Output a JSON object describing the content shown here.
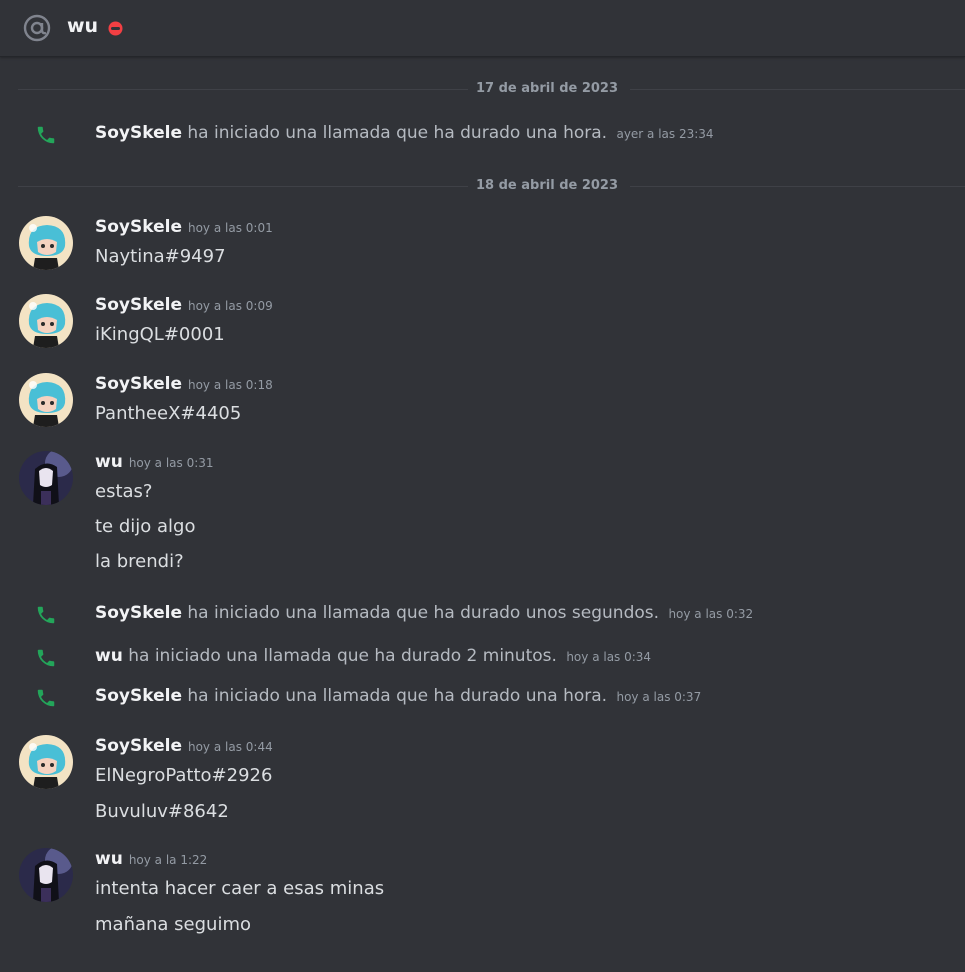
{
  "header": {
    "title": "wu",
    "status": "do-not-disturb",
    "channel_icon": "at-sign-icon"
  },
  "colors": {
    "background": "#313338",
    "call_green": "#23a55a",
    "dnd_red": "#f23f43"
  },
  "dividers": [
    "17 de abril de 2023",
    "18 de abril de 2023"
  ],
  "events": {
    "call1": {
      "who": "SoySkele",
      "text": "ha iniciado una llamada que ha durado una hora.",
      "ts": "ayer a las 23:34"
    },
    "call2": {
      "who": "SoySkele",
      "text": "ha iniciado una llamada que ha durado unos segundos.",
      "ts": "hoy a las 0:32"
    },
    "call3": {
      "who": "wu",
      "text": "ha iniciado una llamada que ha durado 2 minutos.",
      "ts": "hoy a las 0:34"
    },
    "call4": {
      "who": "SoySkele",
      "text": "ha iniciado una llamada que ha durado una hora.",
      "ts": "hoy a las 0:37"
    }
  },
  "messages": [
    {
      "author": "SoySkele",
      "ts": "hoy a las 0:01",
      "lines": [
        "Naytina#9497"
      ]
    },
    {
      "author": "SoySkele",
      "ts": "hoy a las 0:09",
      "lines": [
        "iKingQL#0001"
      ]
    },
    {
      "author": "SoySkele",
      "ts": "hoy a las 0:18",
      "lines": [
        "PantheeX#4405"
      ]
    },
    {
      "author": "wu",
      "ts": "hoy a las 0:31",
      "lines": [
        "estas?",
        "te dijo algo",
        "la brendi?"
      ]
    },
    {
      "author": "SoySkele",
      "ts": "hoy a las 0:44",
      "lines": [
        "ElNegroPatto#2926",
        "Buvuluv#8642"
      ]
    },
    {
      "author": "wu",
      "ts": "hoy a la 1:22",
      "lines": [
        "intenta hacer caer a esas minas",
        "mañana seguimo"
      ]
    }
  ]
}
